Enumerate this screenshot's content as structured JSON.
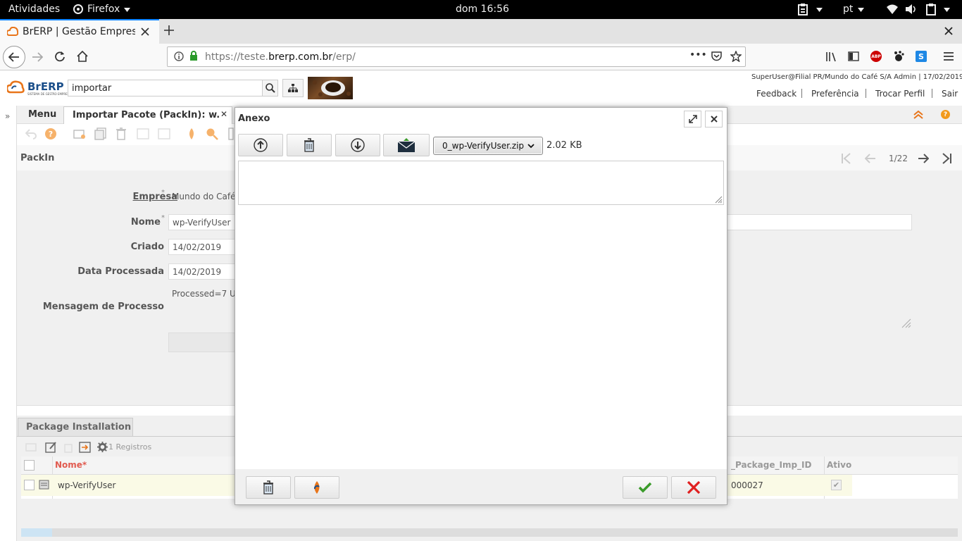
{
  "topbar": {
    "activities": "Atividades",
    "app_menu": "Firefox",
    "clock": "dom 16:56",
    "lang": "pt"
  },
  "browser": {
    "tab_title": "BrERP | Gestão Empresa",
    "url_prefix": "https://teste.",
    "url_domain": "brerp.com.br",
    "url_suffix": "/erp/",
    "ellipsis": "•••"
  },
  "app": {
    "logo_text": "BrERP",
    "logo_tagline": "SISTEMA DE GESTÃO EMPRESARIAL",
    "search_value": "importar",
    "user_info": "SuperUser@Filial PR/Mundo do Café S/A Admin | 17/02/2019",
    "links": [
      "Feedback",
      "Preferência",
      "Trocar Perfil",
      "Sair"
    ]
  },
  "tabs": {
    "menu": "Menu",
    "window": "Importar Pacote (PackIn): w...",
    "close": "✕"
  },
  "window": {
    "header": "PackIn",
    "record_nav": "1/22",
    "fields": {
      "empresa_label": "Empresa",
      "empresa_value": "Mundo do Café",
      "nome_label": "Nome",
      "nome_value": "wp-VerifyUser",
      "criado_label": "Criado",
      "criado_value": "14/02/2019",
      "data_label": "Data Processada",
      "data_value": "14/02/2019",
      "processed_value": "Processed=7 U",
      "mensagem_label": "Mensagem de Processo"
    }
  },
  "detail": {
    "tab": "Package Installation",
    "record_count": "1 Registros",
    "columns": {
      "nome": "Nome*",
      "imp_id": "_Package_Imp_ID",
      "ativo": "Ativo"
    },
    "rows": [
      {
        "nome": "wp-VerifyUser",
        "imp_id": "000027",
        "ativo": "✔"
      }
    ]
  },
  "dialog": {
    "title": "Anexo",
    "file_select": "0_wp-VerifyUser.zip",
    "file_size": "2.02 KB",
    "text_value": ""
  },
  "colors": {
    "accent_orange": "#e8751a",
    "required_red": "#e15b50",
    "ok_green": "#3a9b2a",
    "cancel_red": "#e02020"
  }
}
